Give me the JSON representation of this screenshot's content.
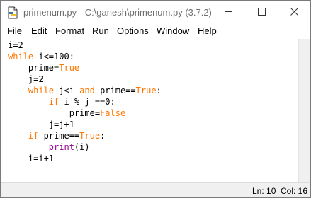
{
  "window": {
    "title": "primenum.py - C:\\ganesh\\primenum.py (3.7.2)"
  },
  "menu": [
    "File",
    "Edit",
    "Format",
    "Run",
    "Options",
    "Window",
    "Help"
  ],
  "editor": {
    "lines": [
      [
        [
          "i=2",
          "plain"
        ]
      ],
      [
        [
          "while",
          "kw"
        ],
        [
          " i<=100:",
          "plain"
        ]
      ],
      [
        [
          "    prime=",
          "plain"
        ],
        [
          "True",
          "kw"
        ]
      ],
      [
        [
          "    j=2",
          "plain"
        ]
      ],
      [
        [
          "    ",
          "plain"
        ],
        [
          "while",
          "kw"
        ],
        [
          " j<i ",
          "plain"
        ],
        [
          "and",
          "kw"
        ],
        [
          " prime==",
          "plain"
        ],
        [
          "True",
          "kw"
        ],
        [
          ":",
          "plain"
        ]
      ],
      [
        [
          "        ",
          "plain"
        ],
        [
          "if",
          "kw"
        ],
        [
          " i % j ==0:",
          "plain"
        ]
      ],
      [
        [
          "            prime=",
          "plain"
        ],
        [
          "False",
          "kw"
        ]
      ],
      [
        [
          "        j=j+1",
          "plain"
        ]
      ],
      [
        [
          "    ",
          "plain"
        ],
        [
          "if",
          "kw"
        ],
        [
          " prime==",
          "plain"
        ],
        [
          "True",
          "kw"
        ],
        [
          ":",
          "plain"
        ]
      ],
      [
        [
          "        ",
          "plain"
        ],
        [
          "print",
          "bi"
        ],
        [
          "(i)",
          "plain"
        ]
      ],
      [
        [
          "    i=i+1",
          "plain"
        ]
      ]
    ]
  },
  "status": {
    "line": "Ln: 10",
    "col": "Col: 16"
  },
  "icons": {
    "app": "python-file-icon",
    "minimize": "minimize-icon",
    "maximize": "maximize-icon",
    "close": "close-icon"
  },
  "colors": {
    "keyword": "#ff7700",
    "builtin": "#900090",
    "title_text": "#6e6e6e",
    "status_bg": "#f0f0f0"
  }
}
